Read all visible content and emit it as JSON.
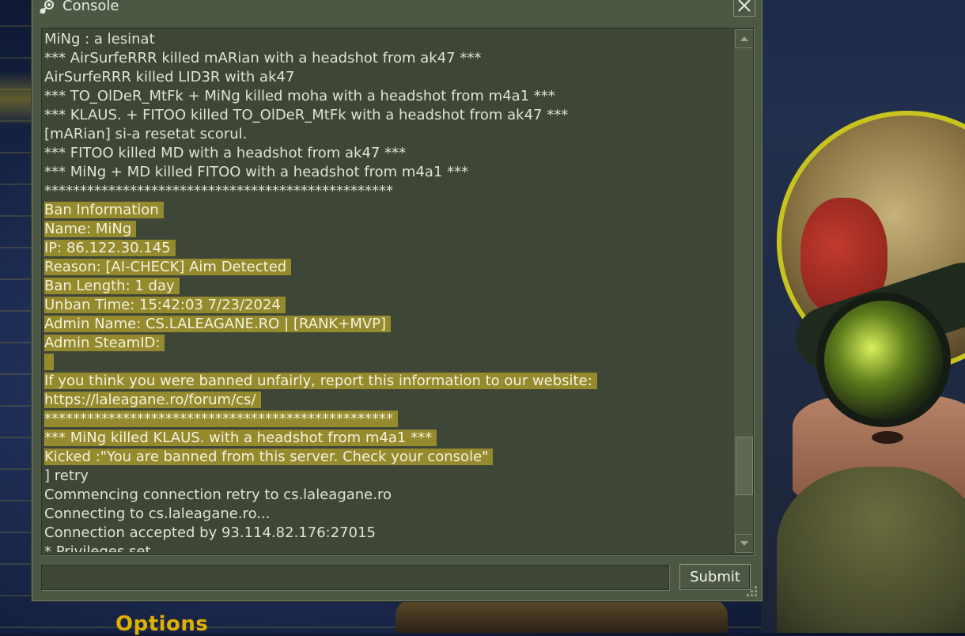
{
  "window": {
    "title": "Console",
    "close_label": "✕"
  },
  "console": {
    "lines": [
      {
        "text": "MiNg : a lesinat",
        "highlight": false
      },
      {
        "text": "*** AirSurfeRRR killed mARian with a headshot from ak47 ***",
        "highlight": false
      },
      {
        "text": "AirSurfeRRR killed LID3R with ak47",
        "highlight": false
      },
      {
        "text": "*** TO_OlDeR_MtFk + MiNg killed moha with a headshot from m4a1 ***",
        "highlight": false
      },
      {
        "text": "*** KLAUS. + FITOO killed TO_OlDeR_MtFk with a headshot from ak47 ***",
        "highlight": false
      },
      {
        "text": "[mARian] si-a resetat scorul.",
        "highlight": false
      },
      {
        "text": "*** FITOO killed MD with a headshot from ak47 ***",
        "highlight": false
      },
      {
        "text": "*** MiNg + MD killed FITOO with a headshot from m4a1 ***",
        "highlight": false
      },
      {
        "text": "*************************************************",
        "highlight": false
      },
      {
        "text": "Ban Information",
        "highlight": true
      },
      {
        "text": "Name: MiNg",
        "highlight": true
      },
      {
        "text": "IP: 86.122.30.145",
        "highlight": true
      },
      {
        "text": "Reason: [AI-CHECK] Aim Detected",
        "highlight": true
      },
      {
        "text": "Ban Length: 1 day",
        "highlight": true
      },
      {
        "text": "Unban Time: 15:42:03 7/23/2024",
        "highlight": true
      },
      {
        "text": "Admin Name: CS.LALEAGANE.RO | [RANK+MVP]",
        "highlight": true
      },
      {
        "text": "Admin SteamID:",
        "highlight": true
      },
      {
        "text": "",
        "highlight": true
      },
      {
        "text": "If you think you were banned unfairly, report this information to our website:",
        "highlight": true
      },
      {
        "text": "https://laleagane.ro/forum/cs/",
        "highlight": true
      },
      {
        "text": "*************************************************",
        "highlight": true
      },
      {
        "text": "*** MiNg killed KLAUS. with a headshot from m4a1 ***",
        "highlight": true
      },
      {
        "text": "Kicked :\"You are banned from this server. Check your console\"",
        "highlight": true
      },
      {
        "text": "] retry",
        "highlight": false
      },
      {
        "text": "Commencing connection retry to cs.laleagane.ro",
        "highlight": false
      },
      {
        "text": "Connecting to cs.laleagane.ro...",
        "highlight": false
      },
      {
        "text": "Connection accepted by 93.114.82.176:27015",
        "highlight": false
      },
      {
        "text": "* Privileges set",
        "highlight": false
      }
    ],
    "input_value": "",
    "submit_label": "Submit"
  },
  "background": {
    "options_label": "Options"
  },
  "icons": {
    "window": "steam-icon",
    "close": "close-icon",
    "scroll_up": "scroll-up-arrow-icon",
    "scroll_down": "scroll-down-arrow-icon",
    "resize": "resize-grip-icon"
  },
  "colors": {
    "panel_bg": "#4c5844",
    "output_bg": "#3e4637",
    "text": "#dde3d6",
    "highlight_bg": "#958a2e",
    "options_text": "#e0b000"
  }
}
